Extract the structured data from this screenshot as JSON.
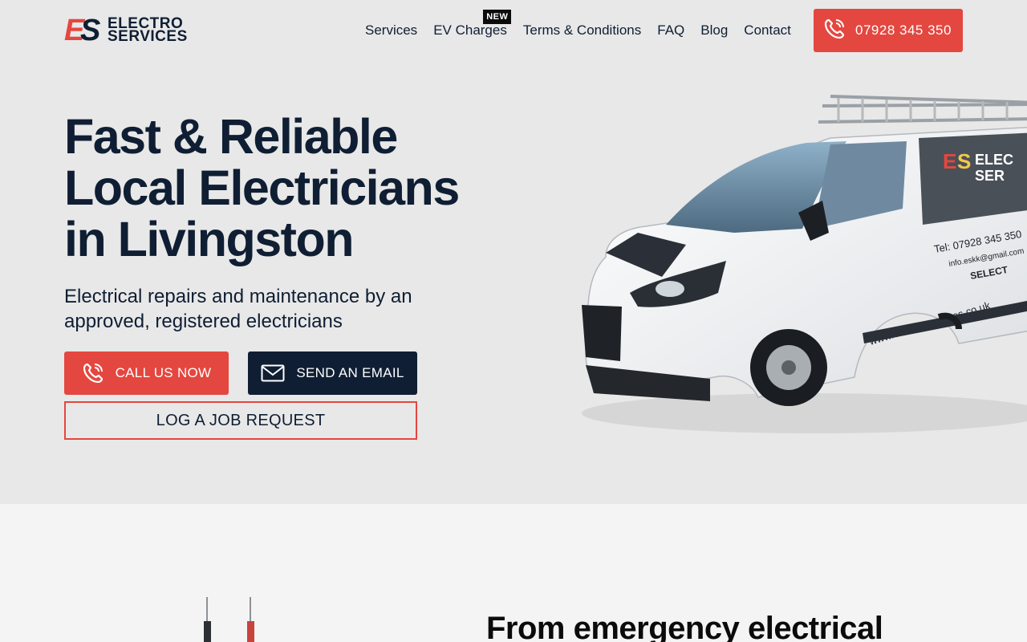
{
  "brand": {
    "line1": "ELECTRO",
    "line2": "SERVICES",
    "mark": "ES"
  },
  "nav": {
    "items": [
      {
        "label": "Services"
      },
      {
        "label": "EV Charges",
        "badge": "NEW"
      },
      {
        "label": "Terms & Conditions"
      },
      {
        "label": "FAQ"
      },
      {
        "label": "Blog"
      },
      {
        "label": "Contact"
      }
    ],
    "phone": "07928 345 350"
  },
  "hero": {
    "title": "Fast & Reliable Local Electricians in Livingston",
    "subtitle": "Electrical repairs and maintenance by an approved, registered electricians",
    "call_label": "CALL US NOW",
    "email_label": "SEND AN EMAIL",
    "job_label": "LOG A JOB REQUEST"
  },
  "van": {
    "brand_line": "ELECTRO SERVICES",
    "tel": "Tel: 07928 345 350",
    "email": "info.eskk@gmail.com",
    "select": "SELECT",
    "web": "www.electro-services.co.uk"
  },
  "section2": {
    "title": "From emergency electrical"
  },
  "colors": {
    "accent": "#e4473f",
    "navy": "#0f1e33",
    "hero_bg": "#e8e8e8",
    "section_bg": "#f4f4f4"
  },
  "icons": {
    "phone": "phone-icon",
    "mail": "mail-icon"
  }
}
